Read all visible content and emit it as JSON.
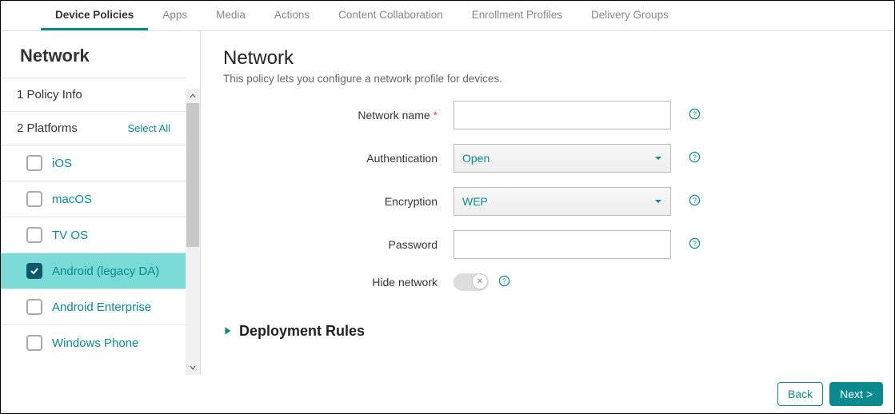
{
  "tabs": {
    "device_policies": "Device Policies",
    "apps": "Apps",
    "media": "Media",
    "actions": "Actions",
    "content_collab": "Content Collaboration",
    "enrollment": "Enrollment Profiles",
    "delivery": "Delivery Groups"
  },
  "sidebar": {
    "title": "Network",
    "step1": "1  Policy Info",
    "step2": "2  Platforms",
    "select_all": "Select All",
    "platforms": {
      "ios": "iOS",
      "macos": "macOS",
      "tvos": "TV OS",
      "android_legacy": "Android (legacy DA)",
      "android_enterprise": "Android Enterprise",
      "windows_phone": "Windows Phone"
    }
  },
  "main": {
    "title": "Network",
    "subtitle": "This policy lets you configure a network profile for devices.",
    "labels": {
      "network_name": "Network name",
      "authentication": "Authentication",
      "encryption": "Encryption",
      "password": "Password",
      "hide_network": "Hide network"
    },
    "values": {
      "network_name": "",
      "authentication": "Open",
      "encryption": "WEP",
      "password": "",
      "hide_network": false
    },
    "deployment_rules": "Deployment Rules"
  },
  "footer": {
    "back": "Back",
    "next": "Next >"
  }
}
